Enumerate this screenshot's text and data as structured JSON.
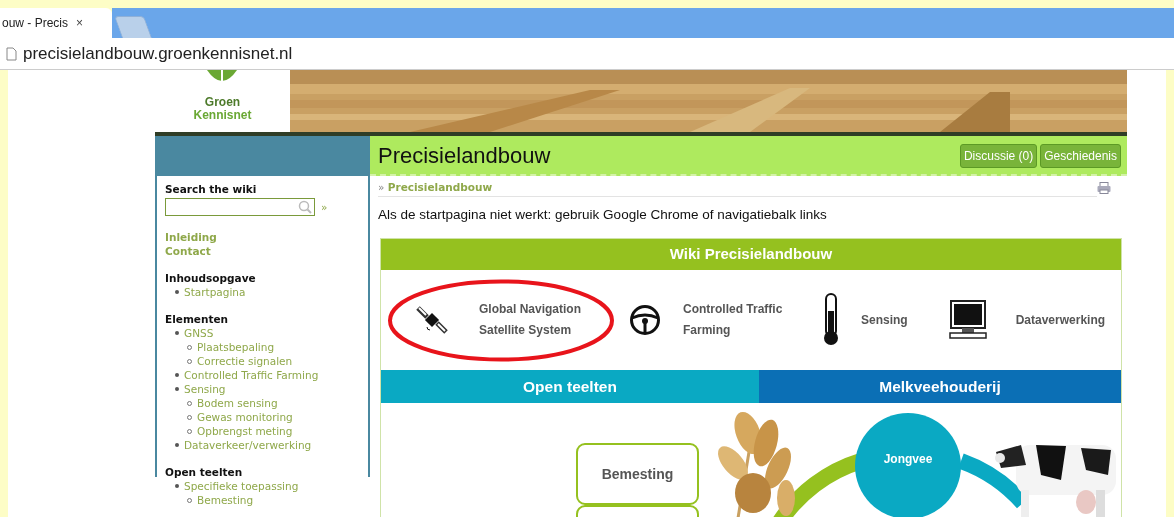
{
  "browser": {
    "tab_title": "ouw - Precis",
    "tab_close": "×",
    "url": "precisielandbouw.groenkennisnet.nl"
  },
  "logo": {
    "line_1": "Groen",
    "line_2": "Kennisnet"
  },
  "page_title": "Precisielandbouw",
  "page_buttons": [
    "Discussie (0)",
    "Geschiedenis"
  ],
  "breadcrumb": {
    "separator": "»",
    "label": "Precisielandbouw"
  },
  "notice": "Als de startpagina niet werkt: gebruik Google Chrome of navigatiebalk links",
  "sidebar": {
    "search_label": "Search the wiki",
    "search_go": "»",
    "links": [
      "Inleiding",
      "Contact"
    ],
    "sections": [
      {
        "heading": "Inhoudsopgave",
        "items": [
          {
            "label": "Startpagina"
          }
        ]
      },
      {
        "heading": "Elementen",
        "items": [
          {
            "label": "GNSS",
            "children": [
              {
                "label": "Plaatsbepaling"
              },
              {
                "label": "Correctie signalen"
              }
            ]
          },
          {
            "label": "Controlled Traffic Farming"
          },
          {
            "label": "Sensing",
            "children": [
              {
                "label": "Bodem sensing"
              },
              {
                "label": "Gewas monitoring"
              },
              {
                "label": "Opbrengst meting"
              }
            ]
          },
          {
            "label": "Dataverkeer/verwerking"
          }
        ]
      },
      {
        "heading": "Open teelten",
        "items": [
          {
            "label": "Specifieke toepassing",
            "children": [
              {
                "label": "Bemesting"
              }
            ]
          }
        ]
      }
    ]
  },
  "infographic": {
    "title": "Wiki Precisielandbouw",
    "features": [
      {
        "kind": "satellite",
        "lines": [
          "Global Navigation",
          "Satellite System"
        ],
        "highlighted": true
      },
      {
        "kind": "wheel",
        "lines": [
          "Controlled Traffic",
          "Farming"
        ],
        "highlighted": false
      },
      {
        "kind": "thermometer",
        "lines": [
          "Sensing"
        ],
        "highlighted": false
      },
      {
        "kind": "monitor",
        "lines": [
          "Dataverwerking"
        ],
        "highlighted": false
      }
    ],
    "tabs": [
      {
        "label": "Open teelten",
        "color": "#0aa9c3"
      },
      {
        "label": "Melkveehouderij",
        "color": "#0b6fb5"
      }
    ],
    "step_box": "Bemesting",
    "circle": "Jongvee"
  }
}
